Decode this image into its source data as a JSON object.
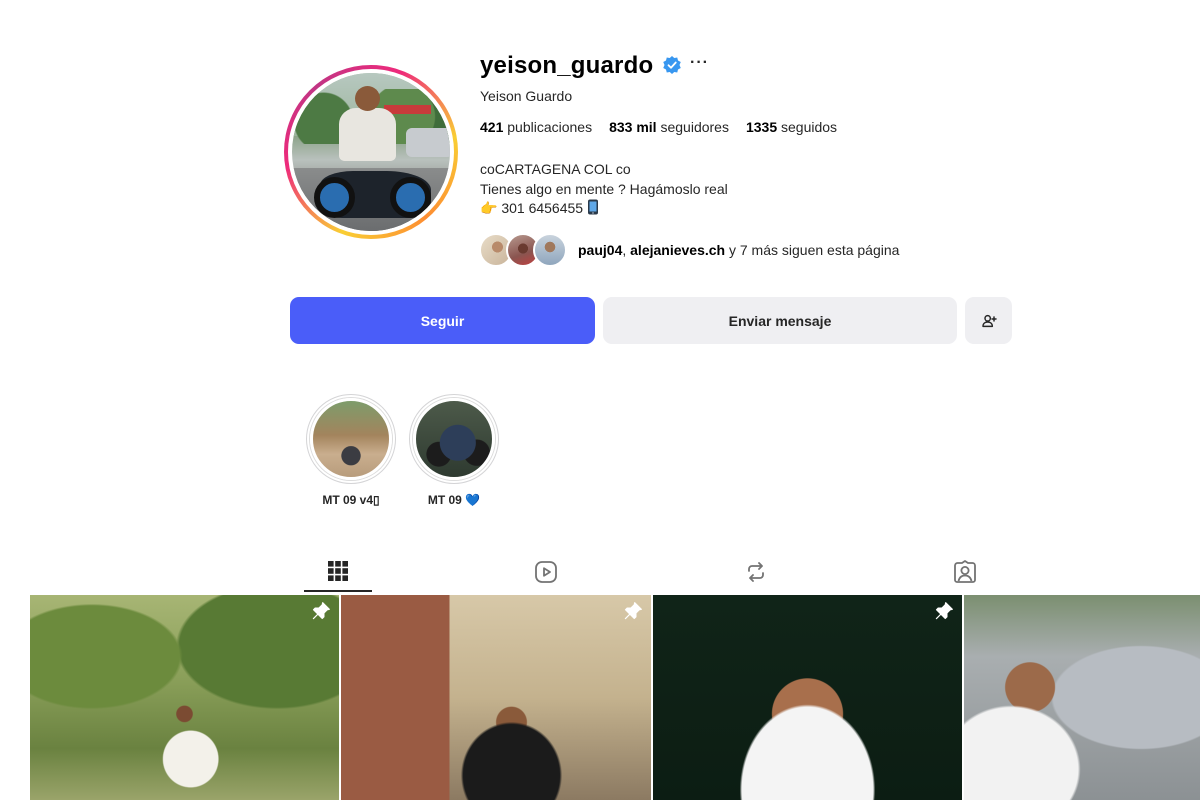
{
  "profile": {
    "username": "yeison_guardo",
    "full_name": "Yeison Guardo",
    "more_label": "···",
    "stats": {
      "posts_count": "421",
      "posts_label": "publicaciones",
      "followers_count": "833 mil",
      "followers_label": "seguidores",
      "following_count": "1335",
      "following_label": "seguidos"
    },
    "bio": {
      "line1": "coCARTAGENA COL co",
      "line2": "Tienes algo en mente ? Hagámoslo real",
      "line3_pre": "👉",
      "line3_phone": " 301 6456455 "
    },
    "followed_by": {
      "user1": "pauj04",
      "separator": ", ",
      "user2": "alejanieves.ch",
      "rest": " y 7 más siguen esta página"
    }
  },
  "actions": {
    "follow_label": "Seguir",
    "message_label": "Enviar mensaje"
  },
  "highlights": [
    {
      "label": "MT 09 v4▯"
    },
    {
      "label": "MT 09 💙"
    }
  ],
  "tabs": [
    "posts-grid-icon",
    "reels-icon",
    "reposts-icon",
    "tagged-icon"
  ],
  "colors": {
    "follow_button": "#4a5df9",
    "secondary_button": "#efeff2",
    "verified_badge": "#3897f0"
  }
}
